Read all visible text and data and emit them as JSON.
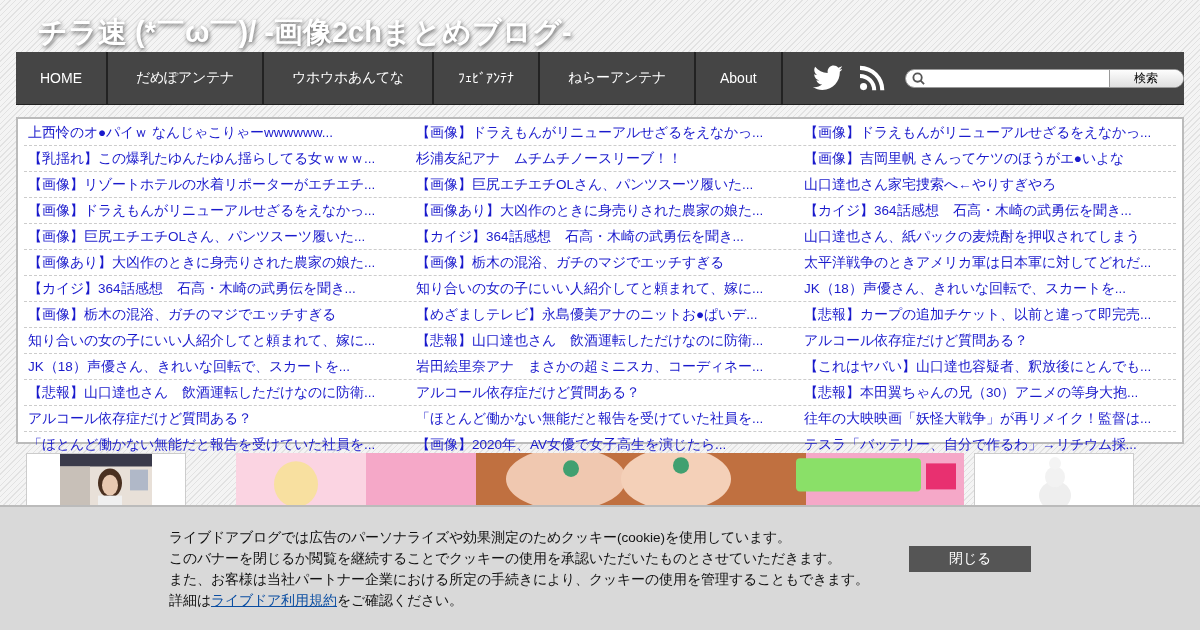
{
  "site_title": "チラ速 (*￣ω￣)/ -画像2chまとめブログ-",
  "nav": [
    {
      "label": "HOME"
    },
    {
      "label": "だめぽアンテナ"
    },
    {
      "label": "ウホウホあんてな"
    },
    {
      "label": "ﾌｪﾋﾞｱﾝﾃﾅ"
    },
    {
      "label": "ねらーアンテナ"
    },
    {
      "label": "About"
    }
  ],
  "search": {
    "button": "検索"
  },
  "links": [
    [
      "上西怜のオ●パイｗ なんじゃこりゃーwwwwww...",
      "【画像】ドラえもんがリニューアルせざるをえなかっ...",
      "【画像】ドラえもんがリニューアルせざるをえなかっ..."
    ],
    [
      "【乳揺れ】この爆乳たゆんたゆん揺らしてる女ｗｗｗ...",
      "杉浦友紀アナ　ムチムチノースリーブ！！",
      "【画像】吉岡里帆 さんってケツのほうがエ●いよな"
    ],
    [
      "【画像】リゾートホテルの水着リポーターがエチエチ...",
      "【画像】巨尻エチエチOLさん、パンツスーツ履いた...",
      "山口達也さん家宅捜索へ←やりすぎやろ"
    ],
    [
      "【画像】ドラえもんがリニューアルせざるをえなかっ...",
      "【画像あり】大凶作のときに身売りされた農家の娘た...",
      "【カイジ】364話感想　石高・木崎の武勇伝を聞き..."
    ],
    [
      "【画像】巨尻エチエチOLさん、パンツスーツ履いた...",
      "【カイジ】364話感想　石高・木崎の武勇伝を聞き...",
      "山口達也さん、紙パックの麦焼酎を押収されてしまう"
    ],
    [
      "【画像あり】大凶作のときに身売りされた農家の娘た...",
      "【画像】栃木の混浴、ガチのマジでエッチすぎる",
      "太平洋戦争のときアメリカ軍は日本軍に対してどれだ..."
    ],
    [
      "【カイジ】364話感想　石高・木崎の武勇伝を聞き...",
      "知り合いの女の子にいい人紹介してと頼まれて、嫁に...",
      "JK（18）声優さん、きれいな回転で、スカートを..."
    ],
    [
      "【画像】栃木の混浴、ガチのマジでエッチすぎる",
      "【めざましテレビ】永島優美アナのニットお●ぱいデ...",
      "【悲報】カープの追加チケット、以前と違って即完売..."
    ],
    [
      "知り合いの女の子にいい人紹介してと頼まれて、嫁に...",
      "【悲報】山口達也さん　飲酒運転しただけなのに防衛...",
      "アルコール依存症だけど質問ある？"
    ],
    [
      "JK（18）声優さん、きれいな回転で、スカートを...",
      "岩田絵里奈アナ　まさかの超ミニスカ、コーディネー...",
      "【これはヤバい】山口達也容疑者、釈放後にとんでも..."
    ],
    [
      "【悲報】山口達也さん　飲酒運転しただけなのに防衛...",
      "アルコール依存症だけど質問ある？",
      "【悲報】本田翼ちゃんの兄（30）アニメの等身大抱..."
    ],
    [
      "アルコール依存症だけど質問ある？",
      "「ほとんど働かない無能だと報告を受けていた社員を...",
      "往年の大映映画「妖怪大戦争」が再リメイク！監督は..."
    ],
    [
      "「ほとんど働かない無能だと報告を受けていた社員を...",
      "【画像】2020年、AV女優で女子高生を演じたら...",
      "テスラ「バッテリー、自分で作るわ」→リチウム採..."
    ]
  ],
  "cookie": {
    "lines": [
      "ライブドアブログでは広告のパーソナライズや効果測定のためクッキー(cookie)を使用しています。",
      "このバナーを閉じるか閲覧を継続することでクッキーの使用を承認いただいたものとさせていただきます。",
      "また、お客様は当社パートナー企業における所定の手続きにより、クッキーの使用を管理することもできます。"
    ],
    "detail_prefix": "詳細は",
    "detail_link": "ライブドア利用規約",
    "detail_suffix": "をご確認ください。",
    "close": "閉じる"
  }
}
